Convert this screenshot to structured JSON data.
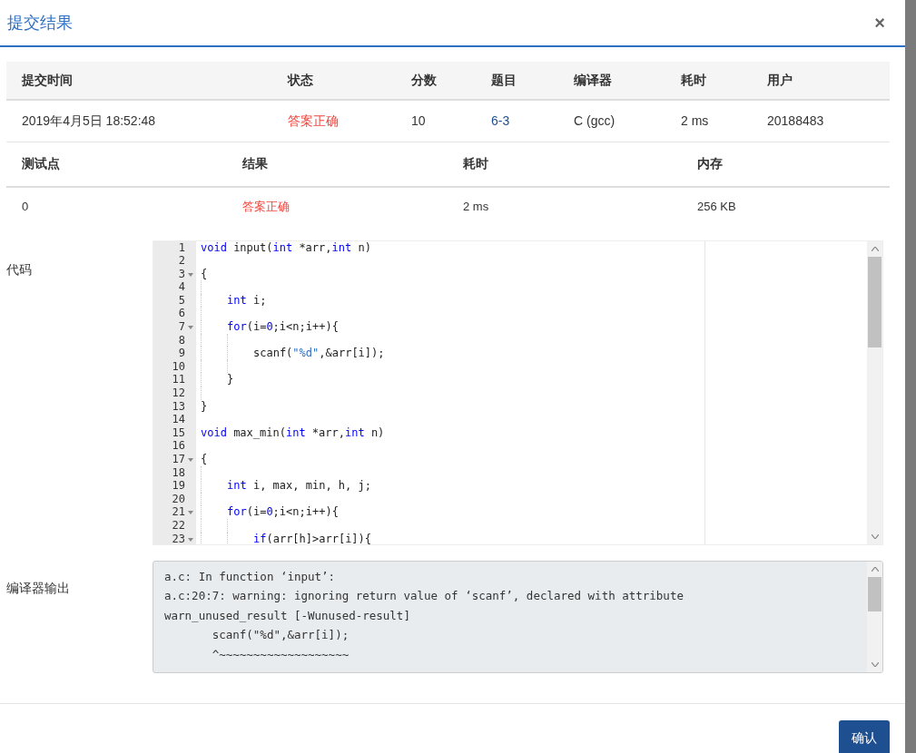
{
  "dialog": {
    "title": "提交结果",
    "close": "×"
  },
  "submission_table": {
    "columns": [
      "提交时间",
      "状态",
      "分数",
      "题目",
      "编译器",
      "耗时",
      "用户"
    ],
    "rows": [
      {
        "time": "2019年4月5日 18:52:48",
        "status": "答案正确",
        "score": "10",
        "problem": "6-3",
        "compiler": "C (gcc)",
        "duration": "2 ms",
        "user": "20188483"
      }
    ]
  },
  "testcase_table": {
    "columns": [
      "测试点",
      "结果",
      "耗时",
      "内存"
    ],
    "rows": [
      {
        "case": "0",
        "result": "答案正确",
        "duration": "2 ms",
        "memory": "256 KB"
      }
    ]
  },
  "code": {
    "label": "代码",
    "lines": [
      {
        "number": "1",
        "segments": [
          {
            "kind": "keyword",
            "text": "void"
          },
          {
            "kind": "plain",
            "text": " input("
          },
          {
            "kind": "keyword",
            "text": "int"
          },
          {
            "kind": "plain",
            "text": " *arr,"
          },
          {
            "kind": "keyword",
            "text": "int"
          },
          {
            "kind": "plain",
            "text": " n)"
          }
        ]
      },
      {
        "number": "2"
      },
      {
        "number": "3",
        "fold": true,
        "segments": [
          {
            "kind": "plain",
            "text": "{"
          }
        ]
      },
      {
        "number": "4"
      },
      {
        "number": "5",
        "segments": [
          {
            "kind": "keyword",
            "text": "int"
          },
          {
            "kind": "plain",
            "text": " i;"
          }
        ]
      },
      {
        "number": "6"
      },
      {
        "number": "7",
        "fold": true,
        "segments": [
          {
            "kind": "keyword",
            "text": "for"
          },
          {
            "kind": "plain",
            "text": "(i="
          },
          {
            "kind": "number",
            "text": "0"
          },
          {
            "kind": "plain",
            "text": ";i<n;i++){"
          }
        ]
      },
      {
        "number": "8"
      },
      {
        "number": "9",
        "segments": [
          {
            "kind": "plain",
            "text": "scanf("
          },
          {
            "kind": "string",
            "text": "\"%d\""
          },
          {
            "kind": "plain",
            "text": ",&arr[i]);"
          }
        ]
      },
      {
        "number": "10"
      },
      {
        "number": "11",
        "segments": [
          {
            "kind": "plain",
            "text": "}"
          }
        ]
      },
      {
        "number": "12"
      },
      {
        "number": "13",
        "segments": [
          {
            "kind": "plain",
            "text": "}"
          }
        ]
      },
      {
        "number": "14"
      },
      {
        "number": "15",
        "segments": [
          {
            "kind": "keyword",
            "text": "void"
          },
          {
            "kind": "plain",
            "text": " max_min("
          },
          {
            "kind": "keyword",
            "text": "int"
          },
          {
            "kind": "plain",
            "text": " *arr,"
          },
          {
            "kind": "keyword",
            "text": "int"
          },
          {
            "kind": "plain",
            "text": " n)"
          }
        ]
      },
      {
        "number": "16"
      },
      {
        "number": "17",
        "fold": true,
        "segments": [
          {
            "kind": "plain",
            "text": "{"
          }
        ]
      },
      {
        "number": "18"
      },
      {
        "number": "19",
        "segments": [
          {
            "kind": "keyword",
            "text": "int"
          },
          {
            "kind": "plain",
            "text": " i, max, min, h, j;"
          }
        ]
      },
      {
        "number": "20"
      },
      {
        "number": "21",
        "fold": true,
        "segments": [
          {
            "kind": "keyword",
            "text": "for"
          },
          {
            "kind": "plain",
            "text": "(i="
          },
          {
            "kind": "number",
            "text": "0"
          },
          {
            "kind": "plain",
            "text": ";i<n;i++){"
          }
        ]
      },
      {
        "number": "22"
      },
      {
        "number": "23",
        "fold": true,
        "segments": [
          {
            "kind": "keyword",
            "text": "if"
          },
          {
            "kind": "plain",
            "text": "(arr[h]>arr[i]){"
          }
        ]
      }
    ]
  },
  "compiler_output": {
    "label": "编译器输出",
    "lines": [
      "a.c: In function ‘input’:",
      "a.c:20:7: warning: ignoring return value of ‘scanf’, declared with attribute",
      "warn_unused_result [-Wunused-result]",
      "       scanf(\"%d\",&arr[i]);",
      "       ^~~~~~~~~~~~~~~~~~~~"
    ]
  },
  "footer": {
    "confirm": "确认"
  }
}
